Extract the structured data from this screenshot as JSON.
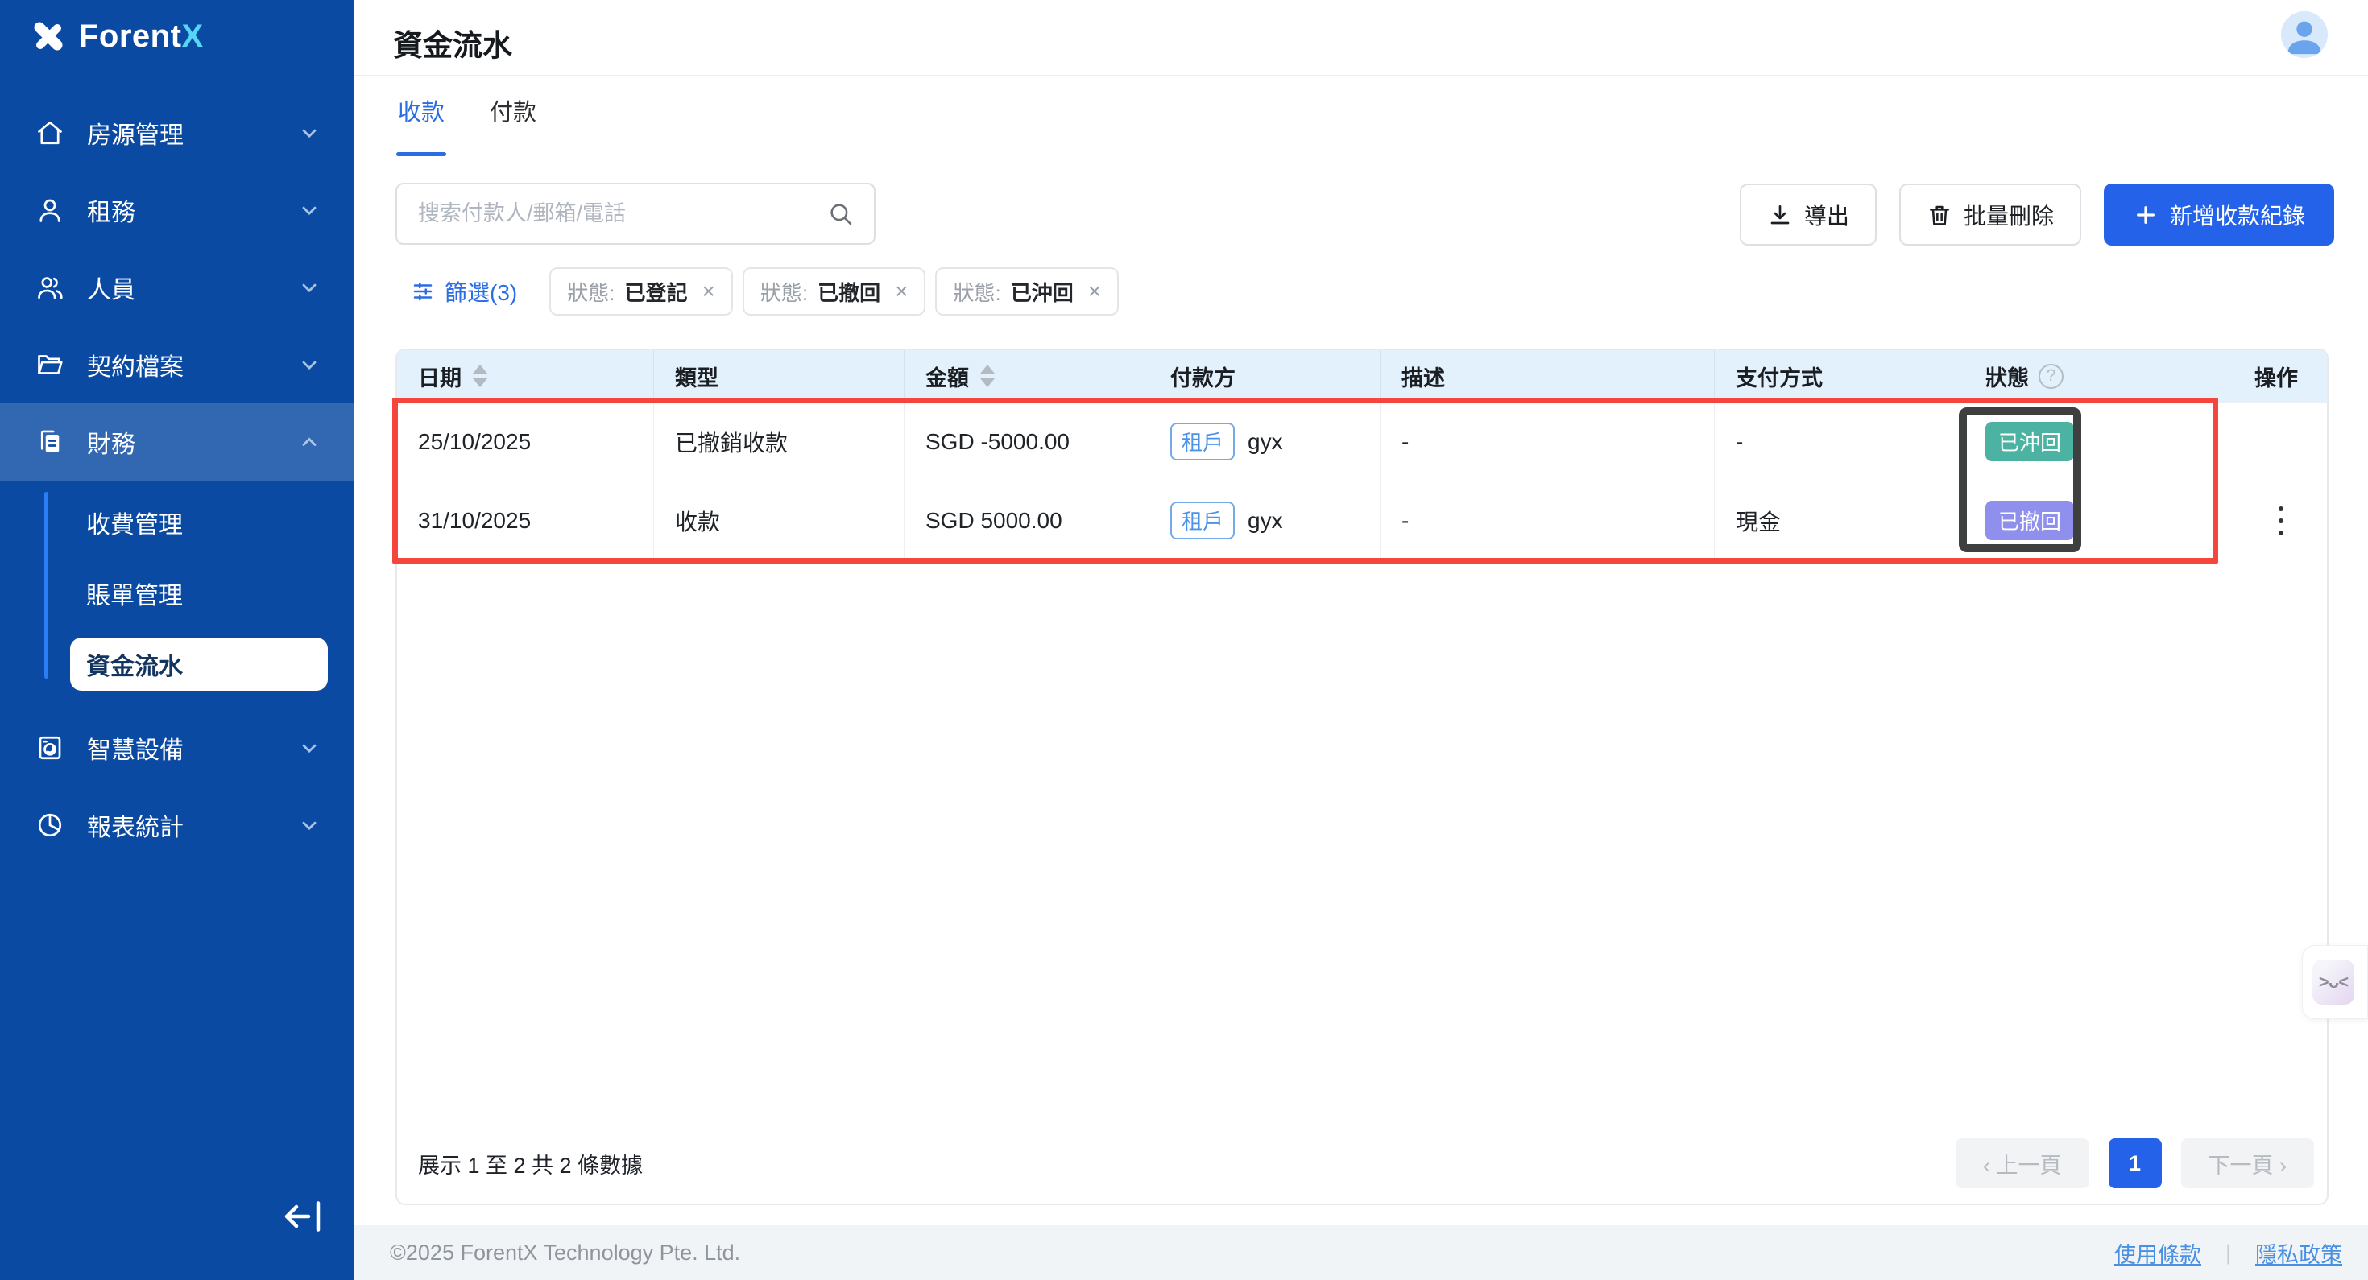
{
  "app": {
    "brand_main": "Forent",
    "brand_accent": "X"
  },
  "sidebar": {
    "items": [
      {
        "label": "房源管理"
      },
      {
        "label": "租務"
      },
      {
        "label": "人員"
      },
      {
        "label": "契約檔案"
      },
      {
        "label": "財務"
      },
      {
        "label": "智慧設備"
      },
      {
        "label": "報表統計"
      }
    ],
    "submenu": [
      {
        "label": "收費管理"
      },
      {
        "label": "賬單管理"
      },
      {
        "label": "資金流水"
      }
    ]
  },
  "header": {
    "title": "資金流水"
  },
  "tabs": {
    "receipts": "收款",
    "payments": "付款"
  },
  "toolbar": {
    "search_placeholder": "搜索付款人/郵箱/電話",
    "export_label": "導出",
    "bulk_delete_label": "批量刪除",
    "add_record_label": "新增收款紀錄"
  },
  "filters": {
    "filter_label": "篩選(3)",
    "chips": [
      {
        "field": "狀態:",
        "value": "已登記",
        "close": "×"
      },
      {
        "field": "狀態:",
        "value": "已撤回",
        "close": "×"
      },
      {
        "field": "狀態:",
        "value": "已沖回",
        "close": "×"
      }
    ]
  },
  "table": {
    "columns": [
      {
        "label": "日期"
      },
      {
        "label": "類型"
      },
      {
        "label": "金額"
      },
      {
        "label": "付款方"
      },
      {
        "label": "描述"
      },
      {
        "label": "支付方式"
      },
      {
        "label": "狀態",
        "help_glyph": "?"
      },
      {
        "label": "操作"
      }
    ],
    "rows": [
      {
        "date": "25/10/2025",
        "type": "已撤銷收款",
        "amount": "SGD -5000.00",
        "payer_tag": "租戶",
        "payer": "gyx",
        "description": "-",
        "method": "-",
        "status": "已沖回",
        "status_color": "#4cb3a2"
      },
      {
        "date": "31/10/2025",
        "type": "收款",
        "amount": "SGD 5000.00",
        "payer_tag": "租戶",
        "payer": "gyx",
        "description": "-",
        "method": "現金",
        "status": "已撤回",
        "status_color": "#8f90ee"
      }
    ]
  },
  "pagination": {
    "summary": "展示 1 至 2 共 2 條數據",
    "prev": "‹ 上一頁",
    "page": "1",
    "next": "下一頁 ›"
  },
  "widget": {
    "face": ">ᴗ<"
  },
  "footer": {
    "copyright": "©2025 ForentX Technology Pte. Ltd.",
    "terms": "使用條款",
    "separator": "|",
    "privacy": "隱私政策"
  },
  "colors": {
    "sidebar_bg": "#0b4aa2",
    "primary_blue": "#2462e9",
    "accent_cyan": "#55d6f5",
    "table_header_bg": "#e3f1fc",
    "badge_teal": "#4cb3a2",
    "badge_purple": "#8f90ee",
    "annotation_red": "#f4463d",
    "annotation_dark": "#3e4040",
    "link_blue": "#4a90e2"
  }
}
